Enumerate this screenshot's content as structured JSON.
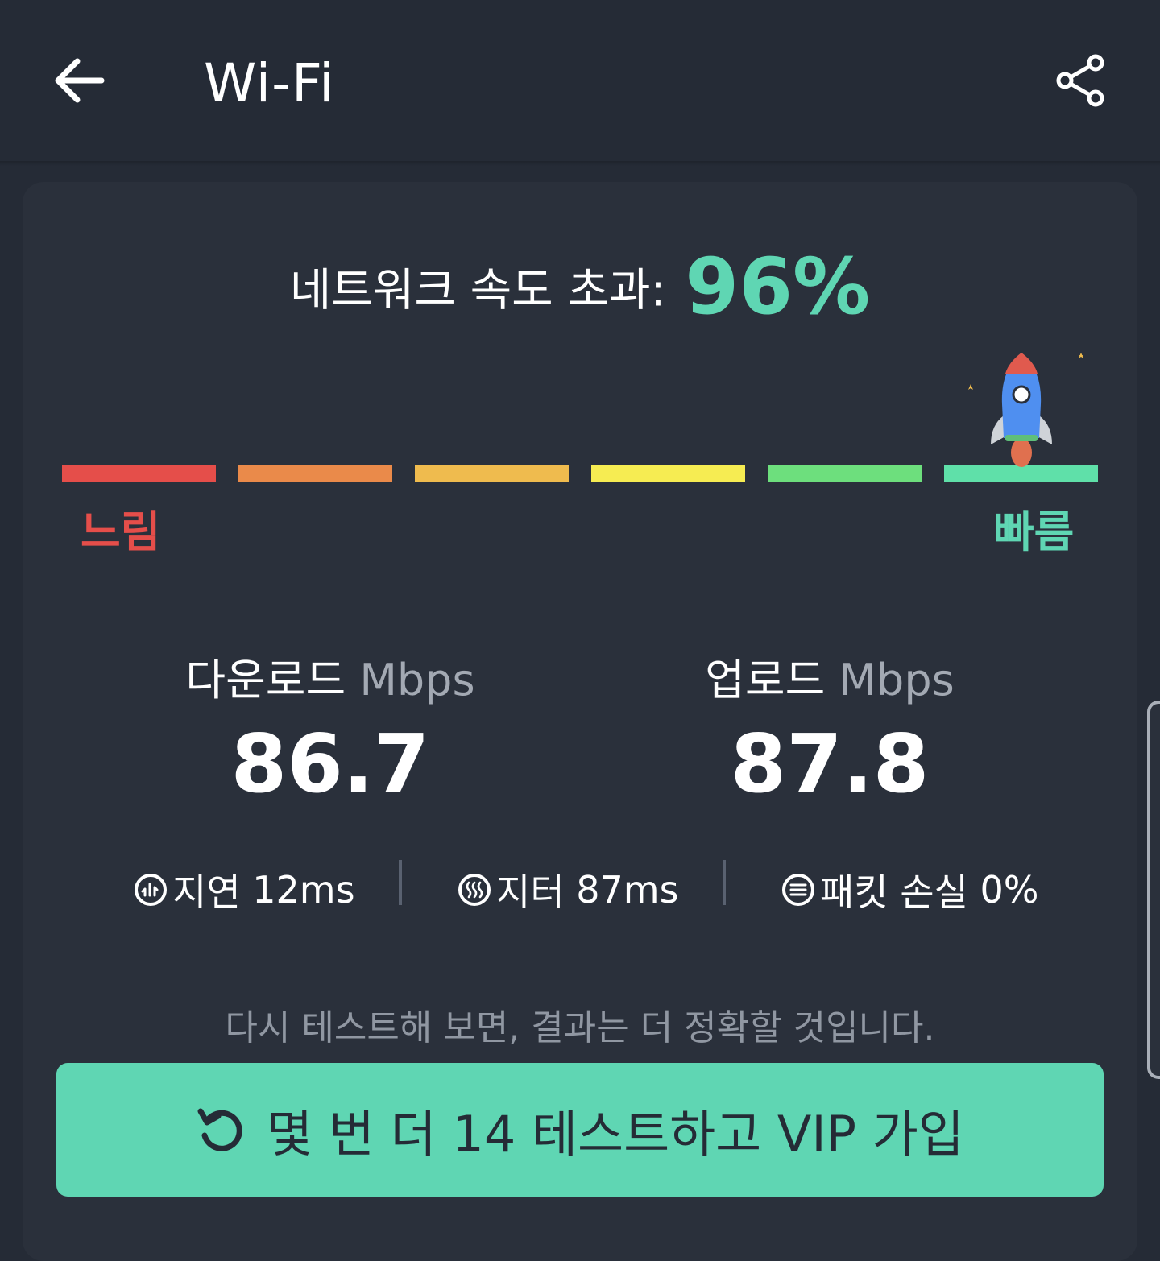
{
  "app_bar": {
    "title": "Wi-Fi",
    "back_icon": "arrow-left-icon",
    "share_icon": "share-icon"
  },
  "speed_summary": {
    "label": "네트워크 속도 초과:",
    "percent": "96%",
    "percent_color": "#5fd6b3"
  },
  "speed_scale": {
    "colors": [
      "#e54e4a",
      "#ea8a4a",
      "#efbb4e",
      "#f6ec52",
      "#6ddf7d",
      "#5fe0a9"
    ],
    "slow_label": "느림",
    "fast_label": "빠름",
    "slow_color": "#e54e4a",
    "fast_color": "#5fd6b3",
    "marker_icon": "rocket-icon",
    "marker_segment": 6
  },
  "download": {
    "label": "다운로드",
    "unit": "Mbps",
    "value": "86.7"
  },
  "upload": {
    "label": "업로드",
    "unit": "Mbps",
    "value": "87.8"
  },
  "stats": {
    "latency": {
      "icon": "latency-icon",
      "label": "지연",
      "value": "12ms"
    },
    "jitter": {
      "icon": "jitter-icon",
      "label": "지터",
      "value": "87ms"
    },
    "packet_loss": {
      "icon": "packet-loss-icon",
      "label": "패킷 손실",
      "value": "0%"
    }
  },
  "hint": "다시 테스트해 보면, 결과는 더 정확할 것입니다.",
  "vip_button": {
    "icon": "refresh-icon",
    "label": "몇 번 더 14 테스트하고 VIP 가입",
    "color": "#5fd6b3"
  }
}
